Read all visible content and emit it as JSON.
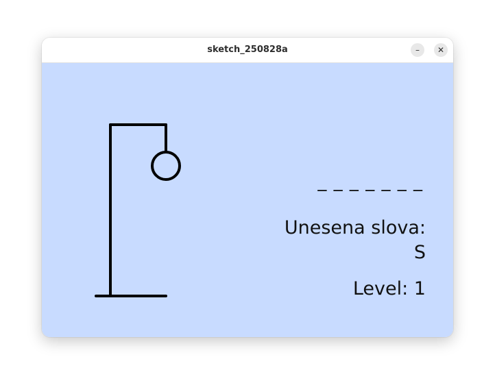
{
  "window": {
    "title": "sketch_250828a",
    "minimize_glyph": "–",
    "close_glyph": "✕"
  },
  "canvas": {
    "background": "#c8dbff"
  },
  "game": {
    "word_mask": "_ _ _ _ _ _ _",
    "entered_label": "Unesena slova:",
    "entered_letters": "S",
    "level_text": "Level: 1",
    "hangman_parts_visible": [
      "base",
      "post",
      "beam",
      "rope",
      "head"
    ]
  }
}
